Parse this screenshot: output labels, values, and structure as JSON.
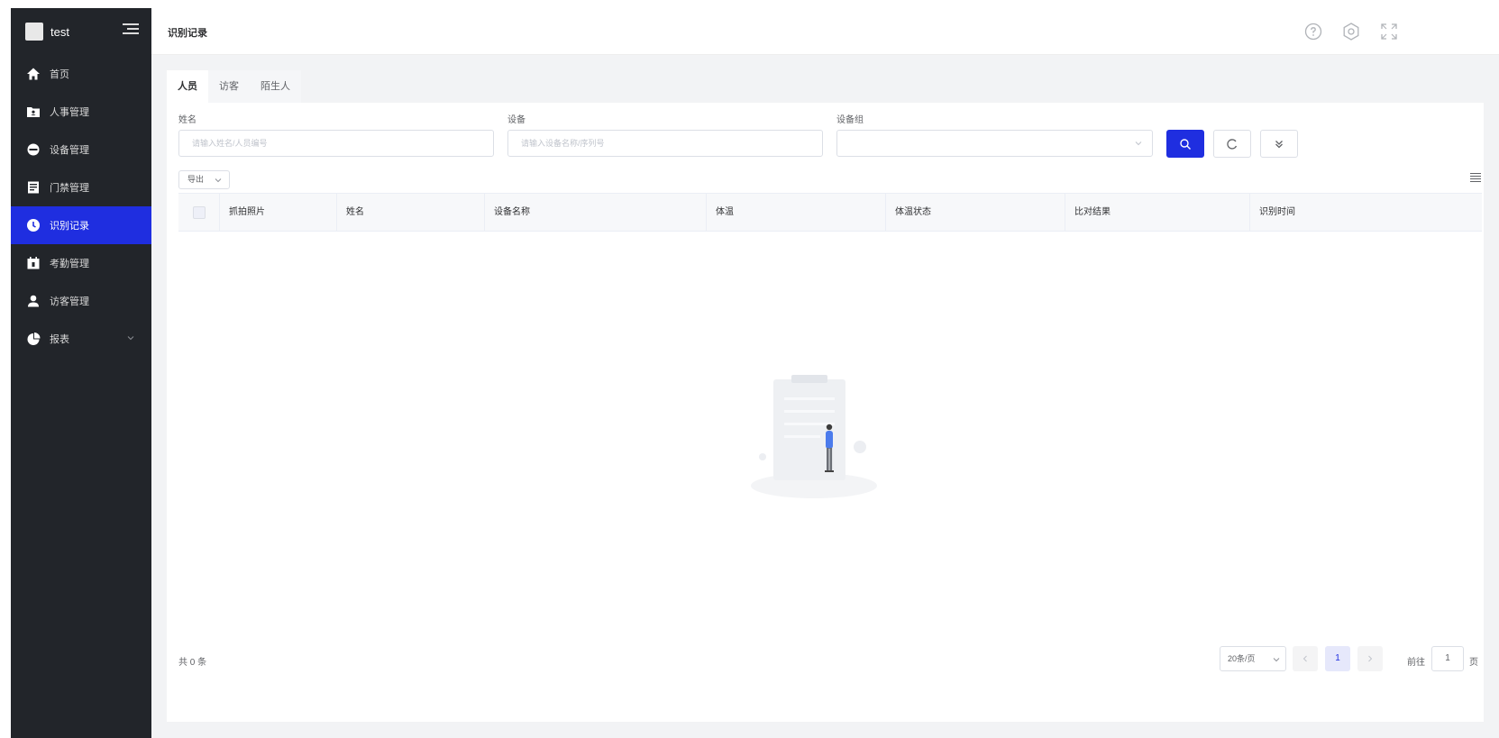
{
  "brand": {
    "name": "test",
    "logo_icon": "app-logo-icon",
    "menu_toggle_icon": "menu-fold-icon"
  },
  "sidebar": {
    "items": [
      {
        "label": "首页",
        "icon": "home-icon"
      },
      {
        "label": "人事管理",
        "icon": "personnel-folder-icon"
      },
      {
        "label": "设备管理",
        "icon": "device-icon"
      },
      {
        "label": "门禁管理",
        "icon": "access-control-icon"
      },
      {
        "label": "识别记录",
        "icon": "clock-icon",
        "active": true
      },
      {
        "label": "考勤管理",
        "icon": "calendar-icon"
      },
      {
        "label": "访客管理",
        "icon": "visitor-icon"
      },
      {
        "label": "报表",
        "icon": "pie-chart-icon",
        "expandable": true
      }
    ],
    "active_color": "#1f2ee0",
    "background": "#22252a"
  },
  "header": {
    "title": "识别记录",
    "icons": [
      "help-icon",
      "settings-icon",
      "fullscreen-icon"
    ]
  },
  "tabs": [
    {
      "label": "人员",
      "active": true
    },
    {
      "label": "访客"
    },
    {
      "label": "陌生人"
    }
  ],
  "filters": {
    "name": {
      "label": "姓名",
      "placeholder": "请输入姓名/人员编号"
    },
    "device": {
      "label": "设备",
      "placeholder": "请输入设备名称/序列号"
    },
    "device_group": {
      "label": "设备组",
      "value": ""
    }
  },
  "toolbar": {
    "export_label": "导出",
    "search_icon": "search-icon",
    "reset_icon": "refresh-icon",
    "expand_icon": "double-chevron-down-icon",
    "column_setting_icon": "column-setting-icon"
  },
  "table": {
    "columns": [
      "抓拍照片",
      "姓名",
      "设备名称",
      "体温",
      "体温状态",
      "比对结果",
      "识别时间"
    ],
    "rows": []
  },
  "pagination": {
    "total_label": "共 0 条",
    "page_size_label": "20条/页",
    "current_page": "1",
    "goto_prefix": "前往",
    "goto_value": "1",
    "goto_suffix": "页"
  },
  "colors": {
    "primary": "#1f2ee0",
    "content_bg": "#f2f3f5"
  }
}
